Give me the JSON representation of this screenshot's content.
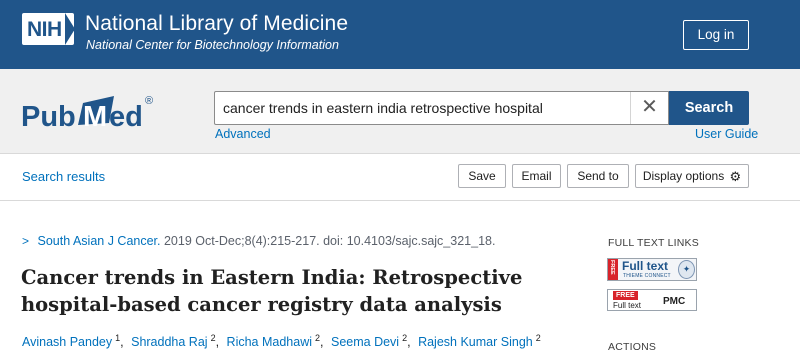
{
  "banner": {
    "logo_text": "NIH",
    "title": "National Library of Medicine",
    "subtitle": "National Center for Biotechnology Information",
    "login_label": "Log in"
  },
  "search": {
    "logo_text": "PubMed",
    "logo_mark": "®",
    "query": "cancer trends in eastern india retrospective hospital",
    "clear_symbol": "✕",
    "button_label": "Search",
    "advanced_label": "Advanced",
    "user_guide_label": "User Guide"
  },
  "actions_bar": {
    "back_link": "Search results",
    "save": "Save",
    "email": "Email",
    "send_to": "Send to",
    "display_options": "Display options"
  },
  "article": {
    "journal": "South Asian J Cancer.",
    "citation": "2019 Oct-Dec;8(4):215-217. doi: 10.4103/sajc.sajc_321_18.",
    "title": "Cancer trends in Eastern India: Retrospective hospital-based cancer registry data analysis",
    "authors": [
      {
        "name": "Avinash Pandey",
        "aff": "1"
      },
      {
        "name": "Shraddha Raj",
        "aff": "2"
      },
      {
        "name": "Richa Madhawi",
        "aff": "2"
      },
      {
        "name": "Seema Devi",
        "aff": "2"
      },
      {
        "name": "Rajesh Kumar Singh",
        "aff": "2"
      }
    ]
  },
  "sidebar": {
    "full_text_links_heading": "FULL TEXT LINKS",
    "badge1": {
      "free": "FREE",
      "title": "Full text",
      "sub": "THIEME CONNECT"
    },
    "badge2": {
      "free": "FREE",
      "title": "Full text",
      "brand": "PMC"
    },
    "actions_heading": "ACTIONS"
  },
  "colors": {
    "nih_blue": "#20558a",
    "link_blue": "#0071bc",
    "search_band": "#f0f0f0",
    "free_red": "#d8232a"
  },
  "icons": [
    "chevron-right-icon",
    "gear-icon",
    "close-icon"
  ]
}
